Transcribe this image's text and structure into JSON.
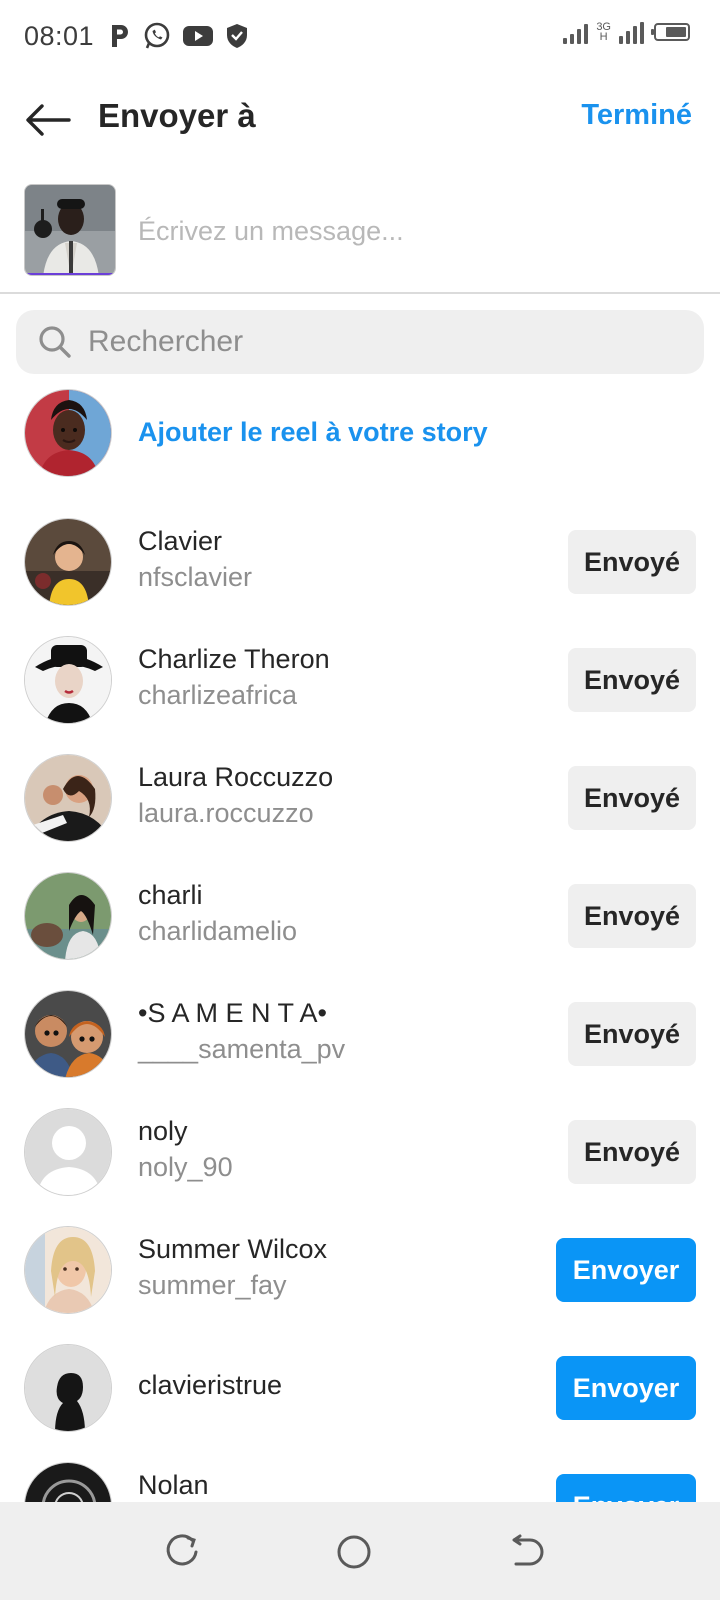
{
  "status_bar": {
    "time": "08:01",
    "network_label_top": "3G",
    "network_label_bottom": "H",
    "icons": [
      "parking-p-icon",
      "whatsapp-icon",
      "youtube-icon",
      "shield-icon",
      "signal-icon",
      "battery-icon"
    ]
  },
  "header": {
    "title": "Envoyer à",
    "done_label": "Terminé",
    "back_icon": "arrow-left-icon"
  },
  "composer": {
    "placeholder": "Écrivez un message..."
  },
  "search": {
    "placeholder": "Rechercher"
  },
  "story": {
    "label": "Ajouter le reel à votre story"
  },
  "contacts": [
    {
      "name": "Clavier",
      "username": "nfsclavier",
      "button": "Envoyé",
      "state": "sent"
    },
    {
      "name": "Charlize Theron",
      "username": "charlizeafrica",
      "button": "Envoyé",
      "state": "sent"
    },
    {
      "name": "Laura Roccuzzo",
      "username": "laura.roccuzzo",
      "button": "Envoyé",
      "state": "sent"
    },
    {
      "name": "charli",
      "username": "charlidamelio",
      "button": "Envoyé",
      "state": "sent"
    },
    {
      "name": "•S A M E N T A•",
      "username": "____samenta_pv",
      "button": "Envoyé",
      "state": "sent"
    },
    {
      "name": "noly",
      "username": "noly_90",
      "button": "Envoyé",
      "state": "sent"
    },
    {
      "name": "Summer Wilcox",
      "username": "summer_fay",
      "button": "Envoyer",
      "state": "send"
    },
    {
      "name": "clavieristrue",
      "username": "",
      "button": "Envoyer",
      "state": "send"
    },
    {
      "name": "Nolan",
      "username": "",
      "button": "Envoyer",
      "state": "send"
    }
  ],
  "colors": {
    "accent": "#1a92ee",
    "send_button": "#0a95f6",
    "sent_button": "#efefef",
    "secondary_text": "#8e8e8e"
  },
  "nav_bar": {
    "icons": [
      "recent-apps-icon",
      "home-icon",
      "back-nav-icon"
    ]
  }
}
